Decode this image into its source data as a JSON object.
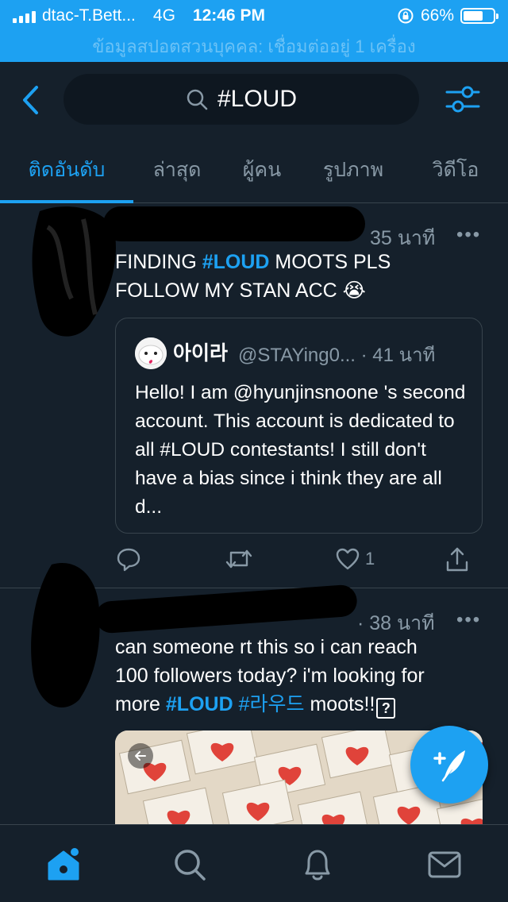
{
  "status_bar": {
    "carrier": "dtac-T.Bett...",
    "network": "4G",
    "time": "12:46 PM",
    "battery": "66%",
    "battery_level": 0.66
  },
  "banner": {
    "text": "ข้อมูลสปอตสวนบุคคล: เชื่อมต่ออยู่ 1 เครื่อง"
  },
  "header": {
    "search_value": "#LOUD"
  },
  "tabs": [
    {
      "label": "ติดอันดับ",
      "active": true
    },
    {
      "label": "ล่าสุด",
      "active": false
    },
    {
      "label": "ผู้คน",
      "active": false
    },
    {
      "label": "รูปภาพ",
      "active": false
    },
    {
      "label": "วิดีโอ",
      "active": false
    }
  ],
  "tweets": [
    {
      "time": "35 นาที",
      "more": "•••",
      "text_line1_a": "FINDING ",
      "text_line1_tag": "#LOUD",
      "text_line1_b": " MOOTS PLS",
      "text_line2": "FOLLOW MY STAN ACC",
      "emoji": "😭",
      "quote": {
        "name": "아이라",
        "handle": "@STAYing0... · 41 นาที",
        "text": "Hello! I am @hyunjinsnoone 's second account. This account is dedicated to all #LOUD contestants! I still don't have a bias since i think they are all d..."
      },
      "actions": {
        "reply": "",
        "retweet": "",
        "like_count": "1",
        "share": ""
      }
    },
    {
      "time": "· 38 นาที",
      "more": "•••",
      "text_line1": "can someone rt this so i can reach",
      "text_line2": "100 followers today? i'm looking for",
      "text_line3_a": "more ",
      "text_line3_tag1": "#LOUD",
      "text_line3_tag2": "#라우드",
      "text_line3_b": " moots!!",
      "text_line3_box": "?"
    }
  ],
  "nav": [
    "home-icon",
    "search-icon",
    "notifications-icon",
    "messages-icon"
  ],
  "colors": {
    "accent": "#1da1f2",
    "background": "#15202b",
    "muted": "#8899a6",
    "border": "#38444d"
  }
}
